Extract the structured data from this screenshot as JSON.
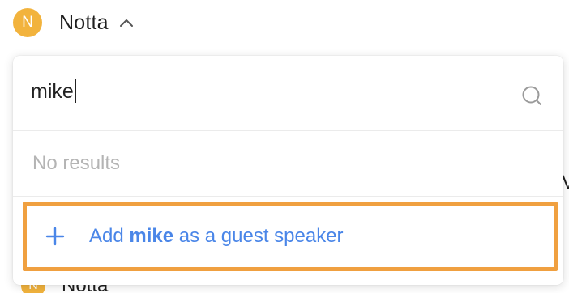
{
  "header": {
    "avatar_initial": "N",
    "title": "Notta",
    "expand_icon": "chevron-up-icon"
  },
  "search": {
    "value": "mike",
    "icon": "search-icon"
  },
  "results": {
    "empty_text": "No results"
  },
  "add_guest": {
    "icon": "plus-icon",
    "prefix": "Add",
    "name": "mike",
    "suffix": "as a guest speaker"
  },
  "background": {
    "avatar_initial": "N",
    "title": "Notta",
    "edge_text": "V"
  },
  "colors": {
    "avatar": "#F2B33D",
    "accent": "#4A86E8",
    "highlight_border": "#F0A040",
    "placeholder_text": "#B4B4B4"
  }
}
